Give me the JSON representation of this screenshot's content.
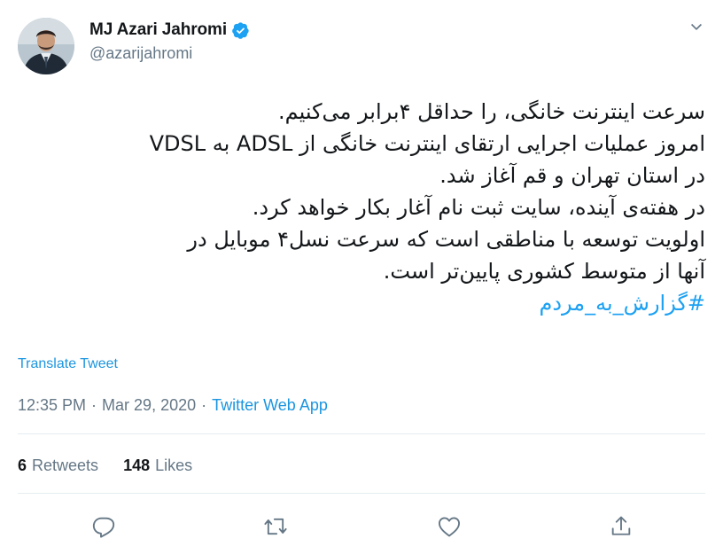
{
  "user": {
    "display_name": "MJ Azari Jahromi",
    "handle": "@azarijahromi",
    "verified": true
  },
  "tweet": {
    "lines": [
      "سرعت اینترنت خانگی، را حداقل ۴برابر می‌کنیم.",
      "امروز عملیات اجرایی ارتقای اینترنت خانگی از ADSL به VDSL",
      "در استان تهران و قم آغاز شد.",
      "در هفته‌ی آینده، سایت ثبت نام آغار بکار خواهد کرد.",
      "اولویت توسعه با مناطقی است که سرعت نسل۴ موبایل در",
      "آنها از متوسط کشوری پایین‌تر است."
    ],
    "hashtag": "#گزارش_به_مردم",
    "translate_label": "Translate Tweet"
  },
  "meta": {
    "time": "12:35 PM",
    "separator": "·",
    "date": "Mar 29, 2020",
    "separator2": "·",
    "source": "Twitter Web App"
  },
  "stats": {
    "retweets_count": "6",
    "retweets_label": "Retweets",
    "likes_count": "148",
    "likes_label": "Likes"
  },
  "actions": {
    "reply_icon": "reply-icon",
    "retweet_icon": "retweet-icon",
    "like_icon": "like-icon",
    "share_icon": "share-icon"
  },
  "colors": {
    "accent": "#1da1f2",
    "link": "#1b95e0",
    "secondary_text": "#657786",
    "primary_text": "#14171a",
    "divider": "#e6ecf0"
  }
}
